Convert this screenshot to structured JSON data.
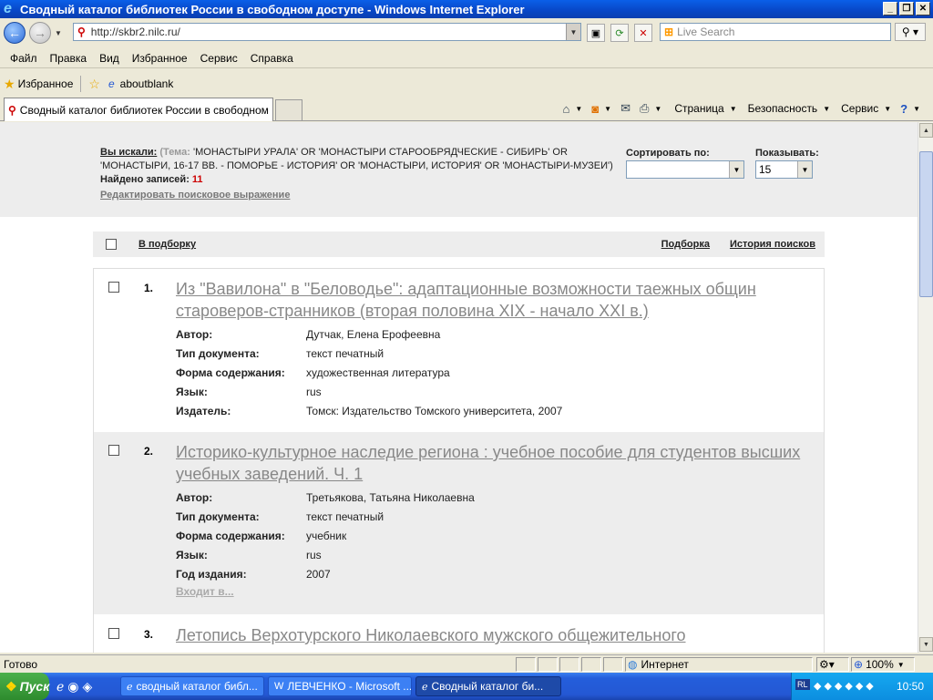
{
  "window": {
    "title": "Сводный каталог библиотек России в свободном доступе - Windows Internet Explorer"
  },
  "address": {
    "url": "http://skbr2.nilc.ru/",
    "search_placeholder": "Live Search"
  },
  "menu": [
    "Файл",
    "Правка",
    "Вид",
    "Избранное",
    "Сервис",
    "Справка"
  ],
  "favorites": {
    "label": "Избранное",
    "link": "aboutblank"
  },
  "tab": {
    "title": "Сводный каталог библиотек России в свободном ..."
  },
  "commandbar": {
    "page": "Страница",
    "security": "Безопасность",
    "tools": "Сервис"
  },
  "search": {
    "searched_label": "Вы искали:",
    "theme_prefix": "(Тема:",
    "query": "'МОНАСТЫРИ УРАЛА' OR 'МОНАСТЫРИ СТАРООБРЯДЧЕСКИЕ - СИБИРЬ' OR 'МОНАСТЫРИ, 16-17 ВВ. - ПОМОРЬЕ - ИСТОРИЯ' OR 'МОНАСТЫРИ, ИСТОРИЯ' OR 'МОНАСТЫРИ-МУЗЕИ')",
    "found_label": "Найдено записей:",
    "found_count": "11",
    "edit_link": "Редактировать поисковое выражение",
    "sort_label": "Сортировать по:",
    "sort_value": "",
    "show_label": "Показывать:",
    "show_value": "15"
  },
  "actions": {
    "to_selection": "В подборку",
    "selection": "Подборка",
    "history": "История поисков"
  },
  "records": [
    {
      "num": "1.",
      "title": "Из \"Вавилона\" в \"Беловодье\": адаптационные возможности таежных общин староверов-странников (вторая половина XIX - начало XXI в.)",
      "fields": [
        {
          "label": "Автор:",
          "value": "Дутчак, Елена Ерофеевна"
        },
        {
          "label": "Тип документа:",
          "value": "текст печатный"
        },
        {
          "label": "Форма содержания:",
          "value": "художественная литература"
        },
        {
          "label": "Язык:",
          "value": "rus"
        },
        {
          "label": "Издатель:",
          "value": "Томск: Издательство Томского университета, 2007"
        }
      ]
    },
    {
      "num": "2.",
      "title": "Историко-культурное наследие региона : учебное пособие для студентов высших учебных заведений. Ч. 1",
      "fields": [
        {
          "label": "Автор:",
          "value": "Третьякова, Татьяна Николаевна"
        },
        {
          "label": "Тип документа:",
          "value": "текст печатный"
        },
        {
          "label": "Форма содержания:",
          "value": "учебник"
        },
        {
          "label": "Язык:",
          "value": "rus"
        },
        {
          "label": "Год издания:",
          "value": "2007"
        }
      ],
      "included": "Входит в..."
    },
    {
      "num": "3.",
      "title": "Летопись Верхотурского Николаевского мужского общежительного"
    }
  ],
  "status": {
    "text": "Готово",
    "zone": "Интернет",
    "zoom": "100%"
  },
  "taskbar": {
    "start": "Пуск",
    "tasks": [
      "сводный каталог библ...",
      "ЛЕВЧЕНКО - Microsoft ...",
      "Сводный каталог би..."
    ],
    "lang": "RL",
    "clock": "10:50"
  },
  "colors": {
    "title_blue": "#0846c6",
    "count_red": "#cc0000",
    "link_gray": "#888888",
    "panel_gray": "#ededed"
  }
}
